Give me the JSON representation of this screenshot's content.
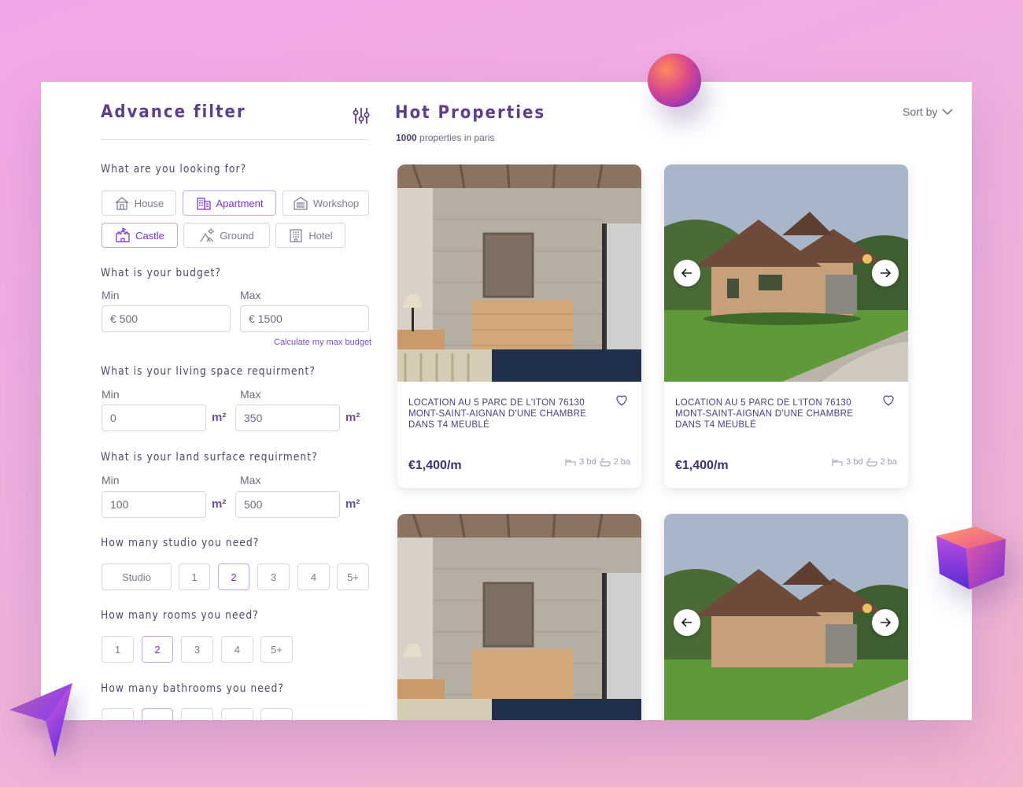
{
  "filter": {
    "title": "Advance filter",
    "filter_icon": "sliders-icon",
    "looking_for": {
      "question": "What are you looking for?",
      "options": [
        {
          "label": "House",
          "icon": "house-icon",
          "selected": false
        },
        {
          "label": "Apartment",
          "icon": "apartment-icon",
          "selected": true
        },
        {
          "label": "Workshop",
          "icon": "workshop-icon",
          "selected": false
        },
        {
          "label": "Castle",
          "icon": "castle-icon",
          "selected": true
        },
        {
          "label": "Ground",
          "icon": "ground-icon",
          "selected": false
        },
        {
          "label": "Hotel",
          "icon": "hotel-icon",
          "selected": false
        }
      ]
    },
    "budget": {
      "question": "What is your budget?",
      "min_label": "Min",
      "max_label": "Max",
      "min_value": "€  500",
      "max_value": "€  1500",
      "link": "Calculate my max budget"
    },
    "living_space": {
      "question": "What is your living space requirment?",
      "min_label": "Min",
      "max_label": "Max",
      "min_value": "0",
      "max_value": "350",
      "unit": "m²"
    },
    "land_surface": {
      "question": "What is your land surface requirment?",
      "min_label": "Min",
      "max_label": "Max",
      "min_value": "100",
      "max_value": "500",
      "unit": "m²"
    },
    "studio": {
      "question": "How many studio you need?",
      "options": [
        "Studio",
        "1",
        "2",
        "3",
        "4",
        "5+"
      ],
      "selected": "2"
    },
    "rooms": {
      "question": "How many rooms you need?",
      "options": [
        "1",
        "2",
        "3",
        "4",
        "5+"
      ],
      "selected": "2"
    },
    "bathrooms": {
      "question": "How many bathrooms you need?",
      "selected": "2"
    }
  },
  "listing": {
    "title": "Hot Properties",
    "count_number": "1000",
    "count_text": "properties in paris",
    "sort_label": "Sort by",
    "cards": [
      {
        "address": "LOCATION AU 5 PARC DE L'ITON 76130 MONT-SAINT-AIGNAN D'UNE CHAMBRE DANS T4 MEUBLÉ",
        "price": "€1,400/m",
        "beds": "3 bd",
        "baths": "2 ba",
        "image": "bedroom-photo"
      },
      {
        "address": "LOCATION AU 5 PARC DE L'ITON 76130 MONT-SAINT-AIGNAN D'UNE CHAMBRE DANS T4 MEUBLÉ",
        "price": "€1,400/m",
        "beds": "3 bd",
        "baths": "2 ba",
        "image": "house-photo"
      },
      {
        "image": "bedroom-photo"
      },
      {
        "image": "house-photo"
      }
    ]
  },
  "colors": {
    "accent": "#5e3f8e",
    "selected": "#7a2fcf",
    "background": "#f0a8e8"
  }
}
